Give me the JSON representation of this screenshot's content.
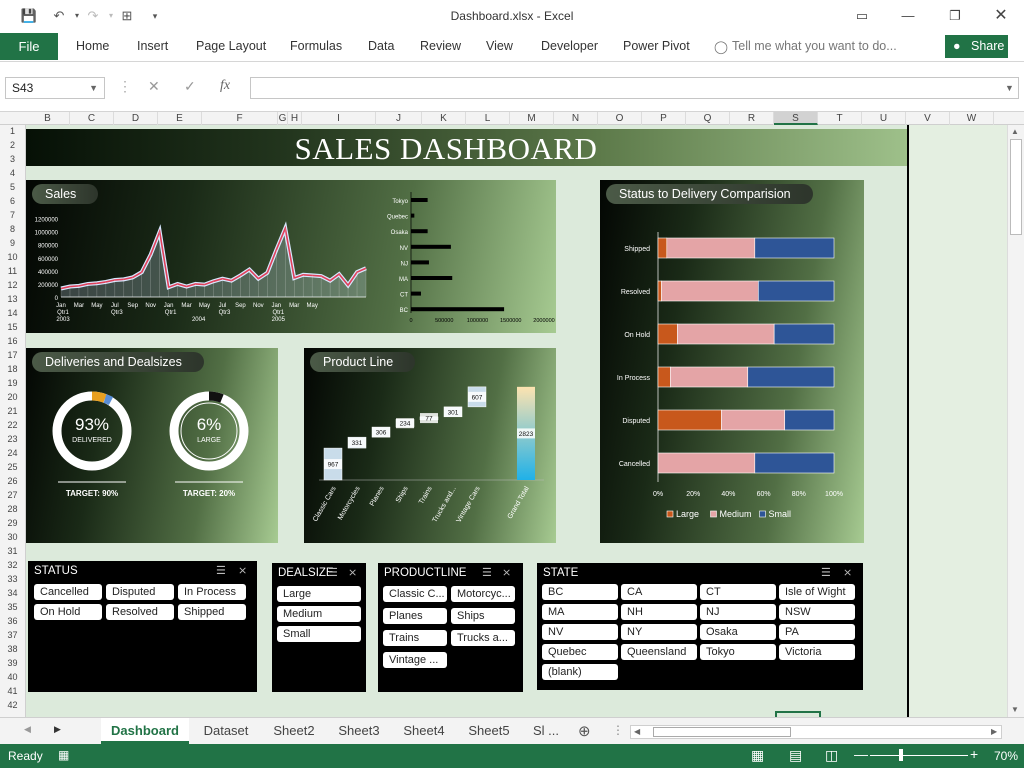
{
  "window": {
    "title": "Dashboard.xlsx - Excel"
  },
  "ribbon": {
    "file": "File",
    "tabs": [
      "Home",
      "Insert",
      "Page Layout",
      "Formulas",
      "Data",
      "Review",
      "View",
      "Developer",
      "Power Pivot"
    ],
    "tell_me": "Tell me what you want to do...",
    "share": "Share"
  },
  "formula_bar": {
    "name_box": "S43",
    "fx": "fx",
    "content": ""
  },
  "columns": [
    "B",
    "C",
    "D",
    "E",
    "F",
    "G",
    "H",
    "I",
    "J",
    "K",
    "L",
    "M",
    "N",
    "O",
    "P",
    "Q",
    "R",
    "S",
    "T",
    "U",
    "V",
    "W"
  ],
  "rows": [
    "1",
    "2",
    "3",
    "4",
    "5",
    "6",
    "7",
    "8",
    "9",
    "10",
    "11",
    "12",
    "13",
    "14",
    "15",
    "16",
    "17",
    "18",
    "19",
    "20",
    "21",
    "22",
    "23",
    "24",
    "25",
    "26",
    "27",
    "28",
    "29",
    "30",
    "31",
    "32",
    "33",
    "34",
    "35",
    "36",
    "37",
    "38",
    "39",
    "40",
    "41",
    "42"
  ],
  "dashboard": {
    "title": "SALES DASHBOARD"
  },
  "panels": {
    "sales": "Sales",
    "status": "Status to Delivery Comparision",
    "deliveries": "Deliveries and Dealsizes",
    "product": "Product Line"
  },
  "kpis": {
    "delivered_pct": "93%",
    "delivered_label": "DELIVERED",
    "delivered_target": "TARGET: 90%",
    "large_pct": "6%",
    "large_label": "LARGE",
    "large_target": "TARGET: 20%"
  },
  "colors": {
    "excel_green": "#217346",
    "large": "#c8581c",
    "medium": "#e4a4a6",
    "small": "#2e5597",
    "sales_line": "#e0405a"
  },
  "chart_data": [
    {
      "type": "line",
      "title": "Sales",
      "y_ticks": [
        "0",
        "200000",
        "400000",
        "600000",
        "800000",
        "1000000",
        "1200000"
      ],
      "ylim": [
        0,
        1300000
      ],
      "x_month_labels": [
        "Jan",
        "Mar",
        "May",
        "Jul",
        "Sep",
        "Nov",
        "Jan",
        "Mar",
        "May",
        "Jul",
        "Sep",
        "Nov",
        "Jan",
        "Mar",
        "May"
      ],
      "x_quarter_labels": [
        "Qtr1",
        "Qtr3",
        "Qtr1",
        "Qtr3",
        "Qtr1"
      ],
      "x_year_labels": [
        "2003",
        "2004",
        "2005"
      ],
      "series": [
        {
          "values": [
            130000,
            160000,
            170000,
            200000,
            210000,
            230000,
            260000,
            270000,
            300000,
            380000,
            650000,
            1000000,
            150000,
            200000,
            160000,
            200000,
            190000,
            240000,
            280000,
            250000,
            330000,
            420000,
            280000,
            370000,
            720000,
            1050000,
            290000,
            340000,
            330000,
            320000,
            250000,
            350000,
            180000,
            380000,
            440000
          ]
        }
      ]
    },
    {
      "type": "bar",
      "orientation": "horizontal",
      "categories": [
        "Tokyo",
        "Quebec",
        "Osaka",
        "NV",
        "NJ",
        "MA",
        "CT",
        "BC"
      ],
      "x_ticks": [
        "0",
        "500000",
        "1000000",
        "1500000",
        "2000000"
      ],
      "xlim": [
        0,
        2000000
      ],
      "series": [
        {
          "values": [
            250000,
            50000,
            250000,
            600000,
            270000,
            620000,
            150000,
            1400000
          ]
        }
      ]
    },
    {
      "type": "bar",
      "orientation": "horizontal",
      "stacked": "percent",
      "categories": [
        "Shipped",
        "Resolved",
        "On Hold",
        "In Process",
        "Disputed",
        "Cancelled"
      ],
      "x_ticks": [
        "0%",
        "20%",
        "40%",
        "60%",
        "80%",
        "100%"
      ],
      "series": [
        {
          "name": "Large",
          "values": [
            5,
            2,
            11,
            7,
            36,
            0
          ]
        },
        {
          "name": "Medium",
          "values": [
            50,
            55,
            55,
            44,
            36,
            55
          ]
        },
        {
          "name": "Small",
          "values": [
            45,
            43,
            34,
            49,
            28,
            45
          ]
        }
      ]
    },
    {
      "type": "waterfall",
      "title": "Product Line",
      "categories": [
        "Classic Cars",
        "Motorcycles",
        "Planes",
        "Ships",
        "Trains",
        "Trucks and...",
        "Vintage Cars",
        "Grand Total"
      ],
      "values": [
        967,
        331,
        306,
        234,
        77,
        301,
        607,
        2823
      ],
      "labels": [
        "967",
        "331",
        "306",
        "234",
        "77",
        "301",
        "607",
        "2823"
      ]
    }
  ],
  "slicers": {
    "status": {
      "title": "STATUS",
      "items": [
        "Cancelled",
        "Disputed",
        "In Process",
        "On Hold",
        "Resolved",
        "Shipped"
      ]
    },
    "dealsize": {
      "title": "DEALSIZE",
      "items": [
        "Large",
        "Medium",
        "Small"
      ]
    },
    "productline": {
      "title": "PRODUCTLINE",
      "items": [
        "Classic C...",
        "Motorcyc...",
        "Planes",
        "Ships",
        "Trains",
        "Trucks a...",
        "Vintage ..."
      ]
    },
    "state": {
      "title": "STATE",
      "items": [
        "BC",
        "CA",
        "CT",
        "Isle of Wight",
        "MA",
        "NH",
        "NJ",
        "NSW",
        "NV",
        "NY",
        "Osaka",
        "PA",
        "Quebec",
        "Queensland",
        "Tokyo",
        "Victoria",
        "(blank)"
      ]
    }
  },
  "sheets": [
    "Dashboard",
    "Dataset",
    "Sheet2",
    "Sheet3",
    "Sheet4",
    "Sheet5",
    "Sl ..."
  ],
  "status_bar": {
    "ready": "Ready",
    "zoom": "70%"
  }
}
